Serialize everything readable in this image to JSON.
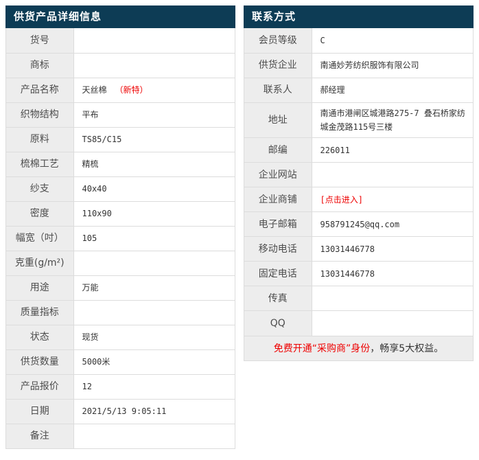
{
  "colors": {
    "header_bg": "#0d3c55",
    "header_fg": "#ffffff",
    "label_bg": "#ededed",
    "label_fg": "#4d4d4d",
    "value_fg": "#333333",
    "border": "#dcdcdc",
    "red": "#ee0000"
  },
  "left_table": {
    "title": "供货产品详细信息",
    "rows": [
      {
        "label": "货号",
        "value": ""
      },
      {
        "label": "商标",
        "value": ""
      },
      {
        "label": "产品名称",
        "value": "天丝棉",
        "value_red": "（新特）"
      },
      {
        "label": "织物结构",
        "value": "平布"
      },
      {
        "label": "原料",
        "value": "TS85/C15"
      },
      {
        "label": "梳棉工艺",
        "value": "精梳"
      },
      {
        "label": "纱支",
        "value": "40x40"
      },
      {
        "label": "密度",
        "value": "110x90"
      },
      {
        "label": "幅宽（吋）",
        "value": "105"
      },
      {
        "label": "克重(g/m²)",
        "value": ""
      },
      {
        "label": "用途",
        "value": "万能"
      },
      {
        "label": "质量指标",
        "value": ""
      },
      {
        "label": "状态",
        "value": "现货"
      },
      {
        "label": "供货数量",
        "value": "5000米"
      },
      {
        "label": "产品报价",
        "value": "12"
      },
      {
        "label": "日期",
        "value": "2021/5/13 9:05:11"
      },
      {
        "label": "备注",
        "value": ""
      }
    ]
  },
  "right_table": {
    "title": "联系方式",
    "rows": [
      {
        "label": "会员等级",
        "value": "C"
      },
      {
        "label": "供货企业",
        "value": "南通妙芳纺织服饰有限公司"
      },
      {
        "label": "联系人",
        "value": "郝经理"
      },
      {
        "label": "地址",
        "value": "南通市港闸区城港路275-7 叠石桥家纺城金茂路115号三楼"
      },
      {
        "label": "邮编",
        "value": "226011"
      },
      {
        "label": "企业网站",
        "value": ""
      },
      {
        "label": "企业商铺",
        "value": "",
        "value_red": "[点击进入]",
        "link": true
      },
      {
        "label": "电子邮箱",
        "value": "958791245@qq.com"
      },
      {
        "label": "移动电话",
        "value": "13031446778"
      },
      {
        "label": "固定电话",
        "value": "13031446778"
      },
      {
        "label": "传真",
        "value": ""
      },
      {
        "label": "QQ",
        "value": ""
      }
    ],
    "footer": {
      "highlight": "免费开通“采购商”身份",
      "rest": "，畅享5大权益。"
    }
  }
}
